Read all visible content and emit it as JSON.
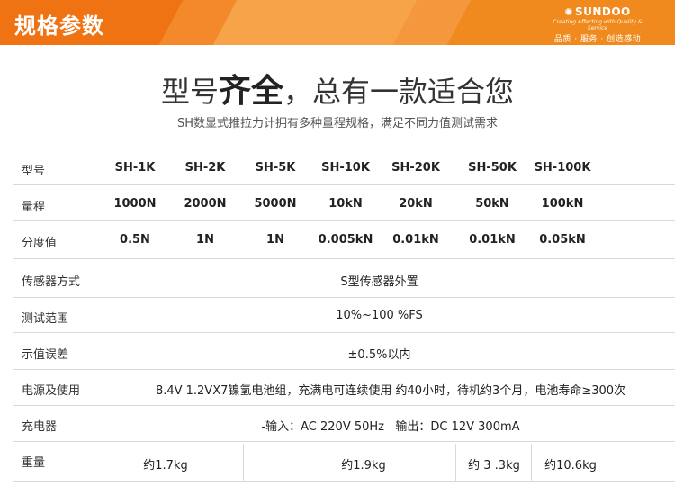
{
  "banner": {
    "title": "规格参数",
    "brand_logo": "SUNDOO",
    "brand_tagline": "Creating Affecting with Quality & Service",
    "brand_slogan": "品质 · 服务 · 创造感动"
  },
  "headline": {
    "prefix": "型号",
    "emphasis": "齐全",
    "suffix": "，总有一款适合您"
  },
  "subline": "SH数显式推拉力计拥有多种量程规格，满足不同力值测试需求",
  "specs": {
    "model": {
      "label": "型号",
      "values": [
        "SH-1K",
        "SH-2K",
        "SH-5K",
        "SH-10K",
        "SH-20K",
        "SH-50K",
        "SH-100K"
      ]
    },
    "range": {
      "label": "量程",
      "values": [
        "1000N",
        "2000N",
        "5000N",
        "10kN",
        "20kN",
        "50kN",
        "100kN"
      ]
    },
    "resolution": {
      "label": "分度值",
      "values": [
        "0.5N",
        "1N",
        "1N",
        "0.005kN",
        "0.01kN",
        "0.01kN",
        "0.05kN"
      ]
    },
    "sensor": {
      "label": "传感器方式",
      "value": "S型传感器外置"
    },
    "test_range": {
      "label": "测试范围",
      "value": "10%~100 %FS"
    },
    "error": {
      "label": "示值误差",
      "value": "±0.5%以内"
    },
    "power": {
      "label": "电源及使用",
      "value": "8.4V 1.2VX7镍氢电池组，充满电可连续使用 约40小时，待机约3个月，电池寿命≥300次"
    },
    "charger": {
      "label": "充电器",
      "value": "-输入：AC 220V 50Hz   输出：DC 12V 300mA"
    },
    "weight": {
      "label": "重量",
      "values": [
        "约1.7kg",
        "约1.9kg",
        "约 3 .3kg",
        "约10.6kg"
      ]
    }
  }
}
